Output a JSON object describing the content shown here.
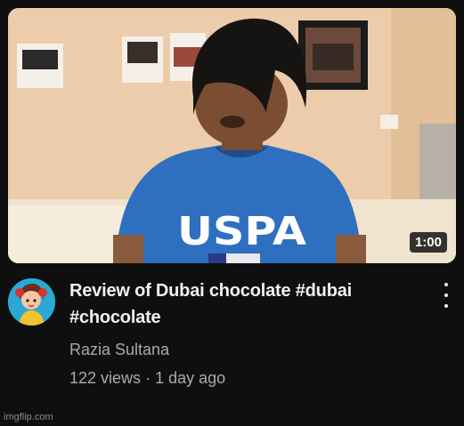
{
  "video": {
    "duration": "1:00",
    "title": "Review of Dubai chocolate #dubai #chocolate",
    "channel": "Razia Sultana",
    "views": "122 views",
    "separator": "·",
    "age": "1 day ago"
  },
  "shirt_text": "USPA",
  "watermark": "imgflip.com",
  "icons": {
    "menu": "more-vert-icon",
    "avatar": "cartoon-girl-avatar"
  },
  "colors": {
    "background": "#0f0f0f",
    "title": "#f1f1f1",
    "secondary": "#aaaaaa",
    "shirt": "#2f6fbf"
  }
}
